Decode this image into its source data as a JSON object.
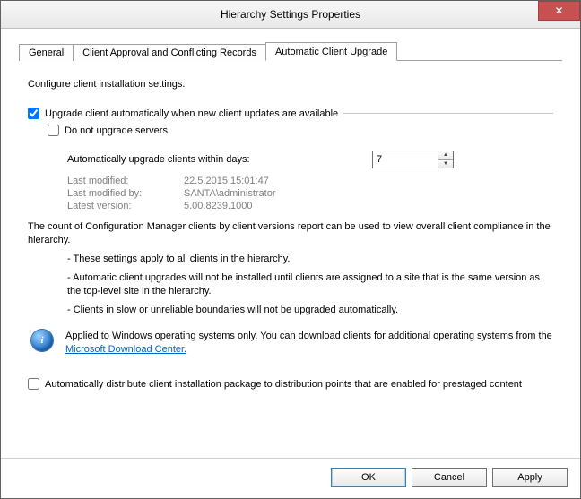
{
  "window": {
    "title": "Hierarchy Settings Properties",
    "close_glyph": "✕"
  },
  "tabs": {
    "general": "General",
    "approval": "Client Approval and Conflicting Records",
    "upgrade": "Automatic Client Upgrade"
  },
  "panel": {
    "instruction": "Configure client installation settings.",
    "chk_upgrade_auto": "Upgrade client automatically when new client updates are available",
    "chk_no_servers": "Do not upgrade servers",
    "days_label": "Automatically upgrade clients within days:",
    "days_value": "7",
    "meta": {
      "modified_label": "Last modified:",
      "modified_value": "22.5.2015 15:01:47",
      "modified_by_label": "Last modified by:",
      "modified_by_value": "SANTA\\administrator",
      "version_label": "Latest version:",
      "version_value": "5.00.8239.1000"
    },
    "count_para": "The count of Configuration Manager clients by client versions report can be used to view overall client compliance in the hierarchy.",
    "bullet1": "- These settings apply to all clients in the hierarchy.",
    "bullet2": "- Automatic client upgrades will not be installed until clients are assigned to a site that is the same version as the top-level site in the hierarchy.",
    "bullet3": "- Clients in slow or unreliable boundaries will not be upgraded automatically.",
    "info_pre": "Applied to Windows operating systems only. You can download clients for additional operating systems from the ",
    "info_link": "Microsoft Download Center.",
    "chk_distribute": "Automatically distribute client installation package to distribution points that are enabled for prestaged content"
  },
  "buttons": {
    "ok": "OK",
    "cancel": "Cancel",
    "apply": "Apply"
  }
}
